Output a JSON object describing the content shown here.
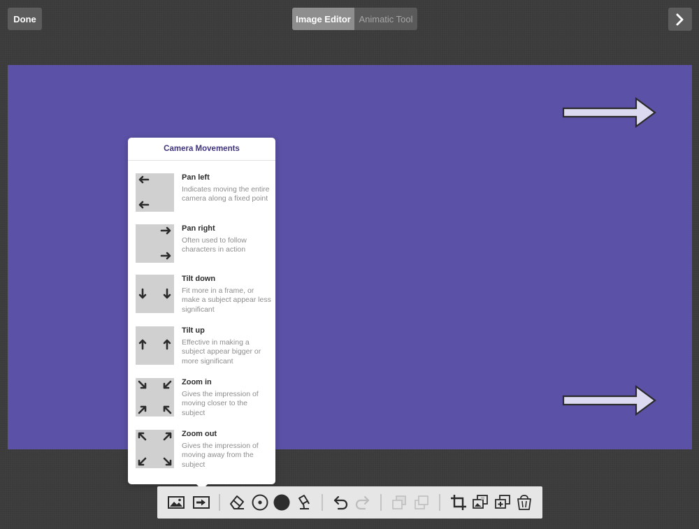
{
  "header": {
    "done_label": "Done",
    "tabs": [
      {
        "label": "Image Editor",
        "active": true
      },
      {
        "label": "Animatic Tool",
        "active": false
      }
    ],
    "next_icon": "chevron-right-icon"
  },
  "canvas": {
    "background_color": "#5b51a6",
    "shapes": [
      "arrow-right-shape",
      "arrow-right-shape"
    ]
  },
  "popover": {
    "title": "Camera Movements",
    "items": [
      {
        "title": "Pan left",
        "description": "Indicates moving the entire camera along a fixed point",
        "icon": "pan-left-icon"
      },
      {
        "title": "Pan right",
        "description": "Often used to follow characters in action",
        "icon": "pan-right-icon"
      },
      {
        "title": "Tilt down",
        "description": "Fit more in a frame, or make a subject appear less significant",
        "icon": "tilt-down-icon"
      },
      {
        "title": "Tilt up",
        "description": "Effective in making a subject appear bigger or more significant",
        "icon": "tilt-up-icon"
      },
      {
        "title": "Zoom in",
        "description": "Gives the impression of moving closer to the subject",
        "icon": "zoom-in-icon"
      },
      {
        "title": "Zoom out",
        "description": "Gives the impression of moving away from the subject",
        "icon": "zoom-out-icon"
      }
    ]
  },
  "toolbar": {
    "tools": [
      "image-icon",
      "camera-movement-icon",
      "eraser-icon",
      "brush-size-icon",
      "color-icon",
      "fill-icon",
      "undo-icon",
      "redo-icon",
      "send-backward-icon",
      "bring-forward-icon",
      "crop-icon",
      "duplicate-icon",
      "add-layer-icon",
      "trash-icon"
    ]
  }
}
